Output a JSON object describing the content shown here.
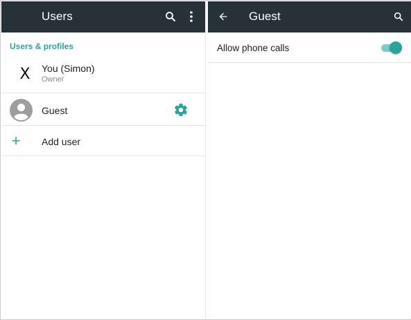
{
  "colors": {
    "appbar": "#263238",
    "accent": "#26a69a",
    "accent_light": "#80cbc4"
  },
  "left_panel": {
    "appbar": {
      "title": "Users",
      "icons": [
        "search-icon",
        "more-vertical-icon"
      ]
    },
    "section_header": "Users & profiles",
    "users": [
      {
        "primary": "You (Simon)",
        "secondary": "Owner",
        "avatar": "X"
      },
      {
        "primary": "Guest",
        "avatar_icon": "person-avatar-icon",
        "action_icon": "gear-icon"
      }
    ],
    "add_user": {
      "label": "Add user",
      "icon": "plus-icon"
    }
  },
  "right_panel": {
    "appbar": {
      "title": "Guest",
      "icons": [
        "back-arrow-icon",
        "search-icon"
      ]
    },
    "preferences": [
      {
        "label": "Allow phone calls",
        "enabled": true
      }
    ]
  }
}
